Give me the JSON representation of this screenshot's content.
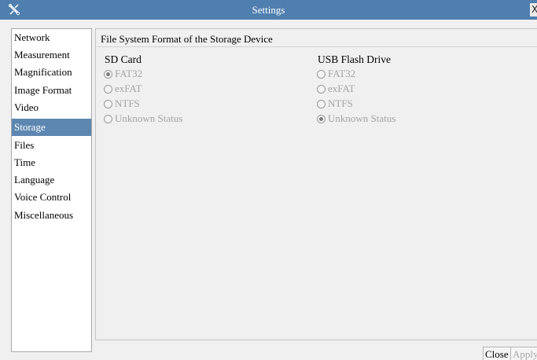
{
  "window": {
    "title": "Settings",
    "app_icon": "tools-icon",
    "close_glyph": "X"
  },
  "sidebar": {
    "items": [
      {
        "label": "Network"
      },
      {
        "label": "Measurement"
      },
      {
        "label": "Magnification"
      },
      {
        "label": "Image Format"
      },
      {
        "label": "Video"
      },
      {
        "label": "Storage",
        "selected": true
      },
      {
        "label": "Files"
      },
      {
        "label": "Time"
      },
      {
        "label": "Language"
      },
      {
        "label": "Voice Control"
      },
      {
        "label": "Miscellaneous"
      }
    ]
  },
  "panel": {
    "title": "File System Format of the Storage Device",
    "sd_card": {
      "title": "SD Card",
      "options": [
        {
          "label": "FAT32",
          "checked": true
        },
        {
          "label": "exFAT",
          "checked": false
        },
        {
          "label": "NTFS",
          "checked": false
        },
        {
          "label": "Unknown Status",
          "checked": false
        }
      ]
    },
    "usb_flash": {
      "title": "USB Flash Drive",
      "options": [
        {
          "label": "FAT32",
          "checked": false
        },
        {
          "label": "exFAT",
          "checked": false
        },
        {
          "label": "NTFS",
          "checked": false
        },
        {
          "label": "Unknown Status",
          "checked": true
        }
      ]
    }
  },
  "buttons": {
    "close": "Close",
    "apply": "Apply"
  },
  "colors": {
    "titlebar": "#4f7fae",
    "selected_item": "#5d87b1",
    "disabled_text": "#a4a4a4"
  }
}
